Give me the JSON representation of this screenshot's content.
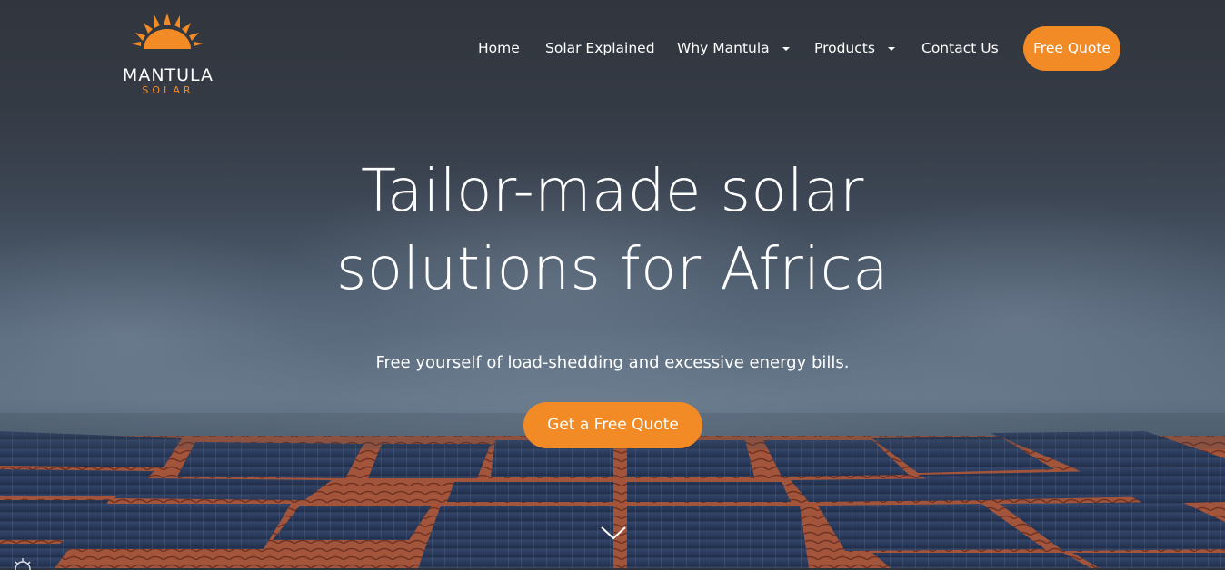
{
  "brand": {
    "name": "MANTULA",
    "sub": "SOLAR",
    "accent_color": "#f28b25"
  },
  "nav": {
    "items": [
      {
        "label": "Home",
        "has_dropdown": false
      },
      {
        "label": "Solar Explained",
        "has_dropdown": false
      },
      {
        "label": "Why Mantula",
        "has_dropdown": true
      },
      {
        "label": "Products",
        "has_dropdown": true
      },
      {
        "label": "Contact Us",
        "has_dropdown": false
      }
    ],
    "cta_label": "Free Quote"
  },
  "hero": {
    "headline_line1": "Tailor-made solar",
    "headline_line2": "solutions for Africa",
    "subheadline": "Free yourself of load-shedding and excessive energy bills.",
    "cta_label": "Get a Free Quote",
    "scroll_icon": "chevron-down-icon"
  }
}
